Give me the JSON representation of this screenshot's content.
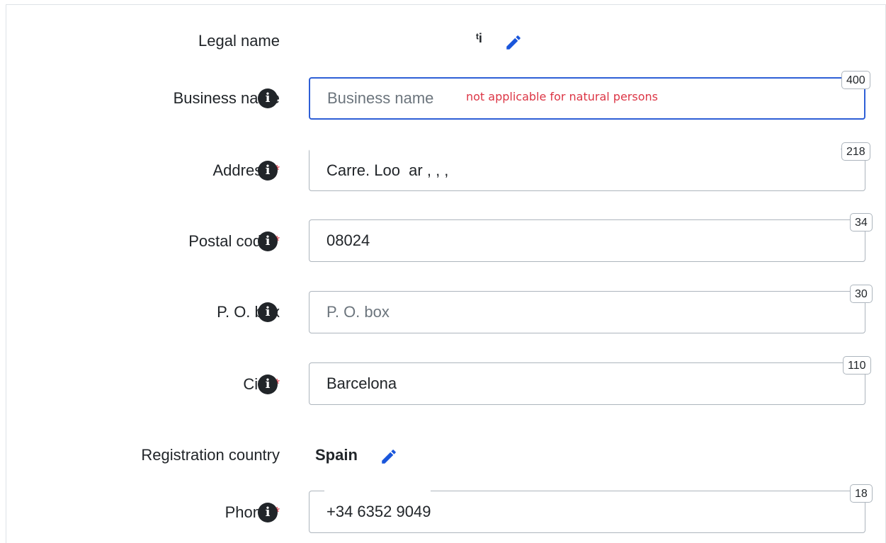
{
  "fields": {
    "legal_name": {
      "label": "Legal name",
      "value": "ᵗi"
    },
    "business_name": {
      "label": "Business name",
      "placeholder": "Business name",
      "value": "",
      "counter": "400",
      "note": "not applicable for natural persons"
    },
    "address": {
      "label": "Address",
      "required_mark": "*",
      "value": "Carre. Loo  ar , , ,",
      "counter": "218"
    },
    "postal_code": {
      "label": "Postal code",
      "required_mark": "*",
      "value": "08024",
      "counter": "34"
    },
    "po_box": {
      "label": "P. O. box",
      "placeholder": "P. O. box",
      "value": "",
      "counter": "30"
    },
    "city": {
      "label": "City",
      "required_mark": "*",
      "value": "Barcelona",
      "counter": "110"
    },
    "registration_country": {
      "label": "Registration country",
      "value": "Spain"
    },
    "phone": {
      "label": "Phone",
      "required_mark": "*",
      "value": "+34 6352 9049",
      "counter": "18"
    }
  },
  "icons": {
    "info": "info-circle-icon",
    "edit": "pencil-icon"
  },
  "colors": {
    "focus_border": "#2e5fd6",
    "required": "#dc3545",
    "pencil": "#1a56db",
    "note": "#dc3545"
  }
}
